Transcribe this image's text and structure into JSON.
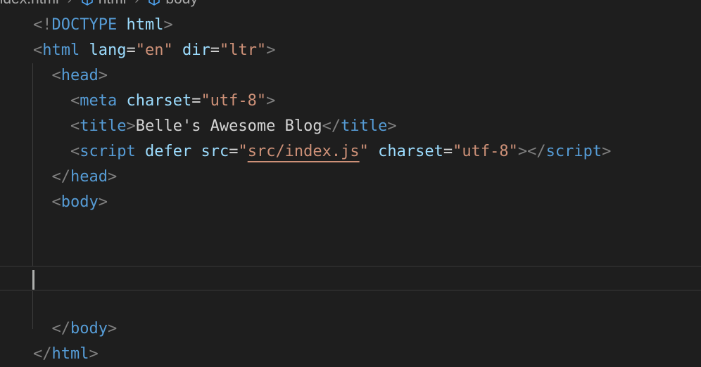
{
  "breadcrumb": {
    "items": [
      {
        "label": "index.html",
        "icon": "file-icon"
      },
      {
        "label": "html",
        "icon": "cube-icon"
      },
      {
        "label": "body",
        "icon": "cube-icon"
      }
    ],
    "separator": "›"
  },
  "editor": {
    "lines": [
      {
        "tokens": [
          {
            "t": "<!",
            "c": "punct"
          },
          {
            "t": "DOCTYPE",
            "c": "doctype-kw"
          },
          {
            "t": " ",
            "c": "text"
          },
          {
            "t": "html",
            "c": "attr"
          },
          {
            "t": ">",
            "c": "punct"
          }
        ]
      },
      {
        "tokens": [
          {
            "t": "<",
            "c": "punct"
          },
          {
            "t": "html",
            "c": "tag"
          },
          {
            "t": " ",
            "c": "text"
          },
          {
            "t": "lang",
            "c": "attr"
          },
          {
            "t": "=",
            "c": "eq"
          },
          {
            "t": "\"en\"",
            "c": "str"
          },
          {
            "t": " ",
            "c": "text"
          },
          {
            "t": "dir",
            "c": "attr"
          },
          {
            "t": "=",
            "c": "eq"
          },
          {
            "t": "\"ltr\"",
            "c": "str"
          },
          {
            "t": ">",
            "c": "punct"
          }
        ]
      },
      {
        "tokens": [
          {
            "t": "  ",
            "c": "text"
          },
          {
            "t": "<",
            "c": "punct"
          },
          {
            "t": "head",
            "c": "tag"
          },
          {
            "t": ">",
            "c": "punct"
          }
        ]
      },
      {
        "tokens": [
          {
            "t": "    ",
            "c": "text"
          },
          {
            "t": "<",
            "c": "punct"
          },
          {
            "t": "meta",
            "c": "tag"
          },
          {
            "t": " ",
            "c": "text"
          },
          {
            "t": "charset",
            "c": "attr"
          },
          {
            "t": "=",
            "c": "eq"
          },
          {
            "t": "\"utf-8\"",
            "c": "str"
          },
          {
            "t": ">",
            "c": "punct"
          }
        ]
      },
      {
        "tokens": [
          {
            "t": "    ",
            "c": "text"
          },
          {
            "t": "<",
            "c": "punct"
          },
          {
            "t": "title",
            "c": "tag"
          },
          {
            "t": ">",
            "c": "punct"
          },
          {
            "t": "Belle's Awesome Blog",
            "c": "text"
          },
          {
            "t": "</",
            "c": "punct"
          },
          {
            "t": "title",
            "c": "tag"
          },
          {
            "t": ">",
            "c": "punct"
          }
        ]
      },
      {
        "tokens": [
          {
            "t": "    ",
            "c": "text"
          },
          {
            "t": "<",
            "c": "punct"
          },
          {
            "t": "script",
            "c": "tag"
          },
          {
            "t": " ",
            "c": "text"
          },
          {
            "t": "defer",
            "c": "attr"
          },
          {
            "t": " ",
            "c": "text"
          },
          {
            "t": "src",
            "c": "attr"
          },
          {
            "t": "=",
            "c": "eq"
          },
          {
            "t": "\"",
            "c": "str"
          },
          {
            "t": "src/index.js",
            "c": "link-str"
          },
          {
            "t": "\"",
            "c": "str"
          },
          {
            "t": " ",
            "c": "text"
          },
          {
            "t": "charset",
            "c": "attr"
          },
          {
            "t": "=",
            "c": "eq"
          },
          {
            "t": "\"utf-8\"",
            "c": "str"
          },
          {
            "t": "></",
            "c": "punct"
          },
          {
            "t": "script",
            "c": "tag"
          },
          {
            "t": ">",
            "c": "punct"
          }
        ]
      },
      {
        "tokens": [
          {
            "t": "  ",
            "c": "text"
          },
          {
            "t": "</",
            "c": "punct"
          },
          {
            "t": "head",
            "c": "tag"
          },
          {
            "t": ">",
            "c": "punct"
          }
        ]
      },
      {
        "tokens": [
          {
            "t": "  ",
            "c": "text"
          },
          {
            "t": "<",
            "c": "punct"
          },
          {
            "t": "body",
            "c": "tag"
          },
          {
            "t": ">",
            "c": "punct"
          }
        ]
      },
      {
        "tokens": []
      },
      {
        "tokens": []
      },
      {
        "tokens": [],
        "current": true
      },
      {
        "tokens": []
      },
      {
        "tokens": [
          {
            "t": "  ",
            "c": "text"
          },
          {
            "t": "</",
            "c": "punct"
          },
          {
            "t": "body",
            "c": "tag"
          },
          {
            "t": ">",
            "c": "punct"
          }
        ]
      },
      {
        "tokens": [
          {
            "t": "</",
            "c": "punct"
          },
          {
            "t": "html",
            "c": "tag"
          },
          {
            "t": ">",
            "c": "punct"
          }
        ]
      }
    ]
  },
  "colors": {
    "background": "#1e1e1e",
    "tag": "#569cd6",
    "attribute": "#9cdcfe",
    "string": "#ce9178",
    "punctuation": "#808080",
    "text": "#d4d4d4"
  }
}
